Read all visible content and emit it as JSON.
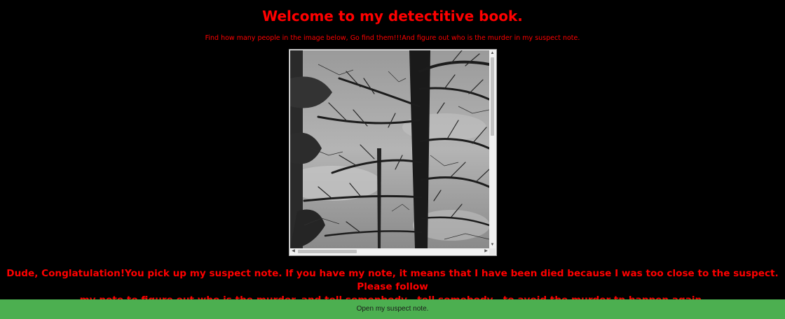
{
  "page": {
    "title": "Welcome to my detectitive book.",
    "instructions": "Find how many people in the image below, Go find them!!!And figure out who is the murder in my suspect note.",
    "note_line1": "Dude, Conglatulation!You pick up my suspect note. If you have my note, it means that I have been died because I was too close to the suspect. Please follow",
    "note_line2": "my note to figure out who is the murder, and tell somenbody...tell somebody...to avoid the murder tp happen again.",
    "button_label": "Open my suspect note."
  },
  "image_panel": {
    "icons": {
      "up": "scroll-up-arrow",
      "down": "scroll-down-arrow",
      "left": "scroll-left-arrow",
      "right": "scroll-right-arrow"
    }
  },
  "colors": {
    "background": "#000000",
    "text": "#ff0000",
    "button": "#4caf50"
  }
}
